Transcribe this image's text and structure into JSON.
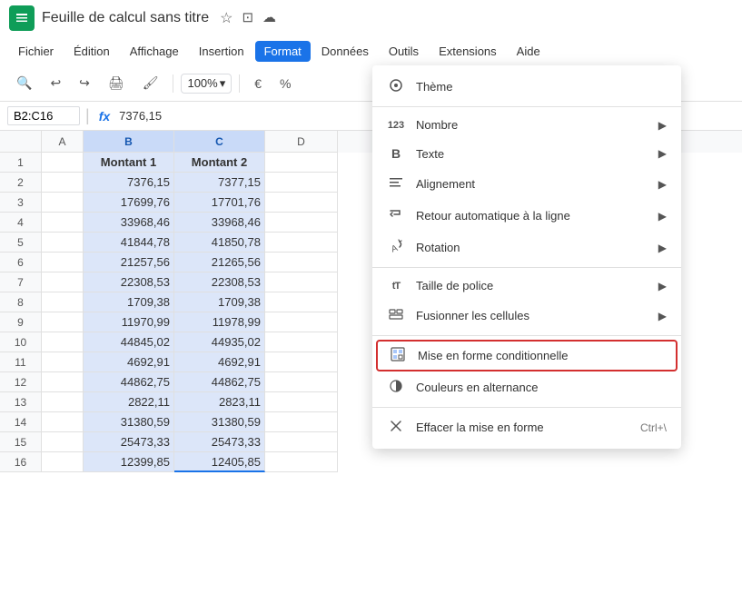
{
  "titleBar": {
    "appIcon": "≡",
    "title": "Feuille de calcul sans titre",
    "starIcon": "★",
    "folderIcon": "📁",
    "cloudIcon": "☁"
  },
  "menuBar": {
    "items": [
      {
        "id": "fichier",
        "label": "Fichier",
        "active": false
      },
      {
        "id": "edition",
        "label": "Édition",
        "active": false
      },
      {
        "id": "affichage",
        "label": "Affichage",
        "active": false
      },
      {
        "id": "insertion",
        "label": "Insertion",
        "active": false
      },
      {
        "id": "format",
        "label": "Format",
        "active": true
      },
      {
        "id": "donnees",
        "label": "Données",
        "active": false
      },
      {
        "id": "outils",
        "label": "Outils",
        "active": false
      },
      {
        "id": "extensions",
        "label": "Extensions",
        "active": false
      },
      {
        "id": "aide",
        "label": "Aide",
        "active": false
      }
    ]
  },
  "toolbar": {
    "zoom": "100%",
    "currency": "€",
    "percent": "%"
  },
  "formulaBar": {
    "cellRef": "B2:C16",
    "formulaValue": "7376,15"
  },
  "columns": [
    {
      "id": "A",
      "label": "A",
      "selected": false
    },
    {
      "id": "B",
      "label": "B",
      "selected": true
    },
    {
      "id": "C",
      "label": "C",
      "selected": true
    },
    {
      "id": "D",
      "label": "D",
      "selected": false
    }
  ],
  "rows": [
    {
      "rowNum": "1",
      "selected": false,
      "A": "",
      "B": "Montant 1",
      "C": "Montant 2",
      "D": "",
      "header": true
    },
    {
      "rowNum": "2",
      "selected": false,
      "A": "",
      "B": "7376,15",
      "C": "7377,15",
      "D": ""
    },
    {
      "rowNum": "3",
      "selected": false,
      "A": "",
      "B": "17699,76",
      "C": "17701,76",
      "D": ""
    },
    {
      "rowNum": "4",
      "selected": false,
      "A": "",
      "B": "33968,46",
      "C": "33968,46",
      "D": ""
    },
    {
      "rowNum": "5",
      "selected": false,
      "A": "",
      "B": "41844,78",
      "C": "41850,78",
      "D": ""
    },
    {
      "rowNum": "6",
      "selected": false,
      "A": "",
      "B": "21257,56",
      "C": "21265,56",
      "D": ""
    },
    {
      "rowNum": "7",
      "selected": false,
      "A": "",
      "B": "22308,53",
      "C": "22308,53",
      "D": ""
    },
    {
      "rowNum": "8",
      "selected": false,
      "A": "",
      "B": "1709,38",
      "C": "1709,38",
      "D": ""
    },
    {
      "rowNum": "9",
      "selected": false,
      "A": "",
      "B": "11970,99",
      "C": "11978,99",
      "D": ""
    },
    {
      "rowNum": "10",
      "selected": false,
      "A": "",
      "B": "44845,02",
      "C": "44935,02",
      "D": ""
    },
    {
      "rowNum": "11",
      "selected": false,
      "A": "",
      "B": "4692,91",
      "C": "4692,91",
      "D": ""
    },
    {
      "rowNum": "12",
      "selected": false,
      "A": "",
      "B": "44862,75",
      "C": "44862,75",
      "D": ""
    },
    {
      "rowNum": "13",
      "selected": false,
      "A": "",
      "B": "2822,11",
      "C": "2823,11",
      "D": ""
    },
    {
      "rowNum": "14",
      "selected": false,
      "A": "",
      "B": "31380,59",
      "C": "31380,59",
      "D": ""
    },
    {
      "rowNum": "15",
      "selected": false,
      "A": "",
      "B": "25473,33",
      "C": "25473,33",
      "D": ""
    },
    {
      "rowNum": "16",
      "selected": false,
      "A": "",
      "B": "12399,85",
      "C": "12405,85",
      "D": ""
    }
  ],
  "dropdownMenu": {
    "items": [
      {
        "id": "theme",
        "icon": "◎",
        "label": "Thème",
        "arrow": false,
        "shortcut": "",
        "highlighted": false,
        "sep_after": false
      },
      {
        "id": "sep1",
        "separator": true
      },
      {
        "id": "nombre",
        "icon": "123",
        "label": "Nombre",
        "arrow": true,
        "shortcut": "",
        "highlighted": false,
        "sep_after": false
      },
      {
        "id": "texte",
        "icon": "B",
        "label": "Texte",
        "arrow": true,
        "shortcut": "",
        "highlighted": false,
        "sep_after": false
      },
      {
        "id": "alignement",
        "icon": "≡",
        "label": "Alignement",
        "arrow": true,
        "shortcut": "",
        "highlighted": false,
        "sep_after": false
      },
      {
        "id": "retour",
        "icon": "↵",
        "label": "Retour automatique à la ligne",
        "arrow": true,
        "shortcut": "",
        "highlighted": false,
        "sep_after": false
      },
      {
        "id": "rotation",
        "icon": "↗",
        "label": "Rotation",
        "arrow": true,
        "shortcut": "",
        "highlighted": false,
        "sep_after": false
      },
      {
        "id": "sep2",
        "separator": true
      },
      {
        "id": "taille",
        "icon": "tT",
        "label": "Taille de police",
        "arrow": true,
        "shortcut": "",
        "highlighted": false,
        "sep_after": false
      },
      {
        "id": "fusionner",
        "icon": "⊞",
        "label": "Fusionner les cellules",
        "arrow": true,
        "shortcut": "",
        "highlighted": false,
        "sep_after": false
      },
      {
        "id": "sep3",
        "separator": true
      },
      {
        "id": "mef",
        "icon": "▦",
        "label": "Mise en forme conditionnelle",
        "arrow": false,
        "shortcut": "",
        "highlighted": true,
        "sep_after": false
      },
      {
        "id": "alternance",
        "icon": "◑",
        "label": "Couleurs en alternance",
        "arrow": false,
        "shortcut": "",
        "highlighted": false,
        "sep_after": false
      },
      {
        "id": "sep4",
        "separator": true
      },
      {
        "id": "effacer",
        "icon": "✕",
        "label": "Effacer la mise en forme",
        "arrow": false,
        "shortcut": "Ctrl+\\",
        "highlighted": false,
        "sep_after": false
      }
    ]
  }
}
